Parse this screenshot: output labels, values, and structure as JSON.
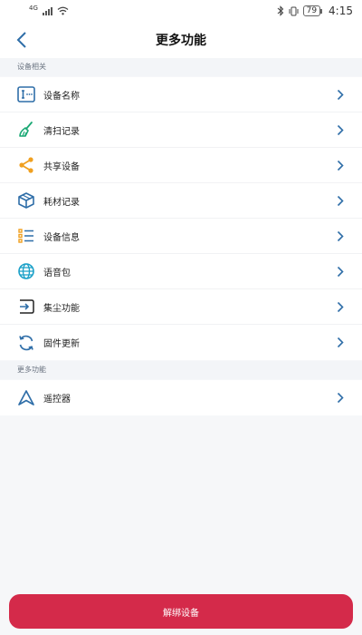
{
  "status_bar": {
    "network": "4G",
    "battery": "79",
    "time": "4:15"
  },
  "header": {
    "title": "更多功能"
  },
  "sections": [
    {
      "title": "设备相关",
      "items": [
        {
          "label": "设备名称",
          "icon": "rename-icon"
        },
        {
          "label": "清扫记录",
          "icon": "broom-icon"
        },
        {
          "label": "共享设备",
          "icon": "share-icon"
        },
        {
          "label": "耗材记录",
          "icon": "box-icon"
        },
        {
          "label": "设备信息",
          "icon": "list-icon"
        },
        {
          "label": "语音包",
          "icon": "globe-icon"
        },
        {
          "label": "集尘功能",
          "icon": "dust-collect-icon"
        },
        {
          "label": "固件更新",
          "icon": "refresh-icon"
        }
      ]
    },
    {
      "title": "更多功能",
      "items": [
        {
          "label": "遥控器",
          "icon": "navigation-arrow-icon"
        }
      ]
    }
  ],
  "footer": {
    "unbind_label": "解绑设备"
  },
  "colors": {
    "accent": "#2f6ea8",
    "danger": "#d42a4a",
    "share": "#f0a020",
    "broom": "#1aa874"
  }
}
